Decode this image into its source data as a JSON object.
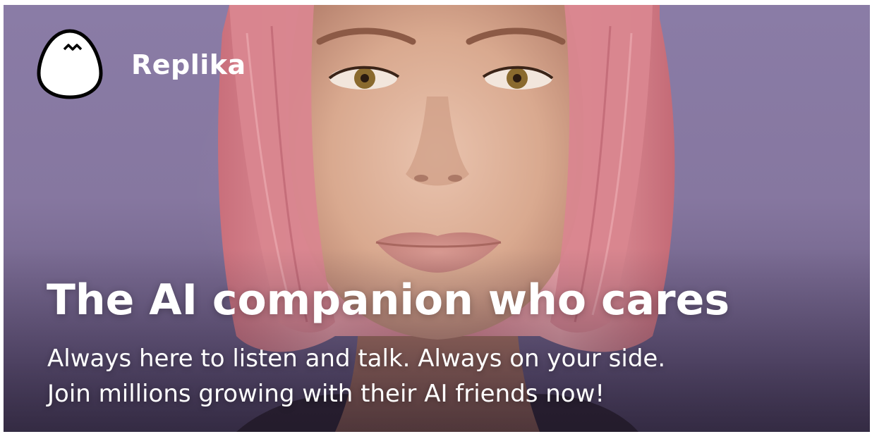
{
  "brand": {
    "name": "Replika",
    "logo_icon": "egg-icon"
  },
  "hero": {
    "headline": "The AI companion who cares",
    "subline_1": "Always here to listen and talk. Always on your side.",
    "subline_2": "Join millions growing with their AI friends now!"
  },
  "colors": {
    "background": "#8a7ca6",
    "hair": "#d9878f",
    "text": "#ffffff"
  }
}
